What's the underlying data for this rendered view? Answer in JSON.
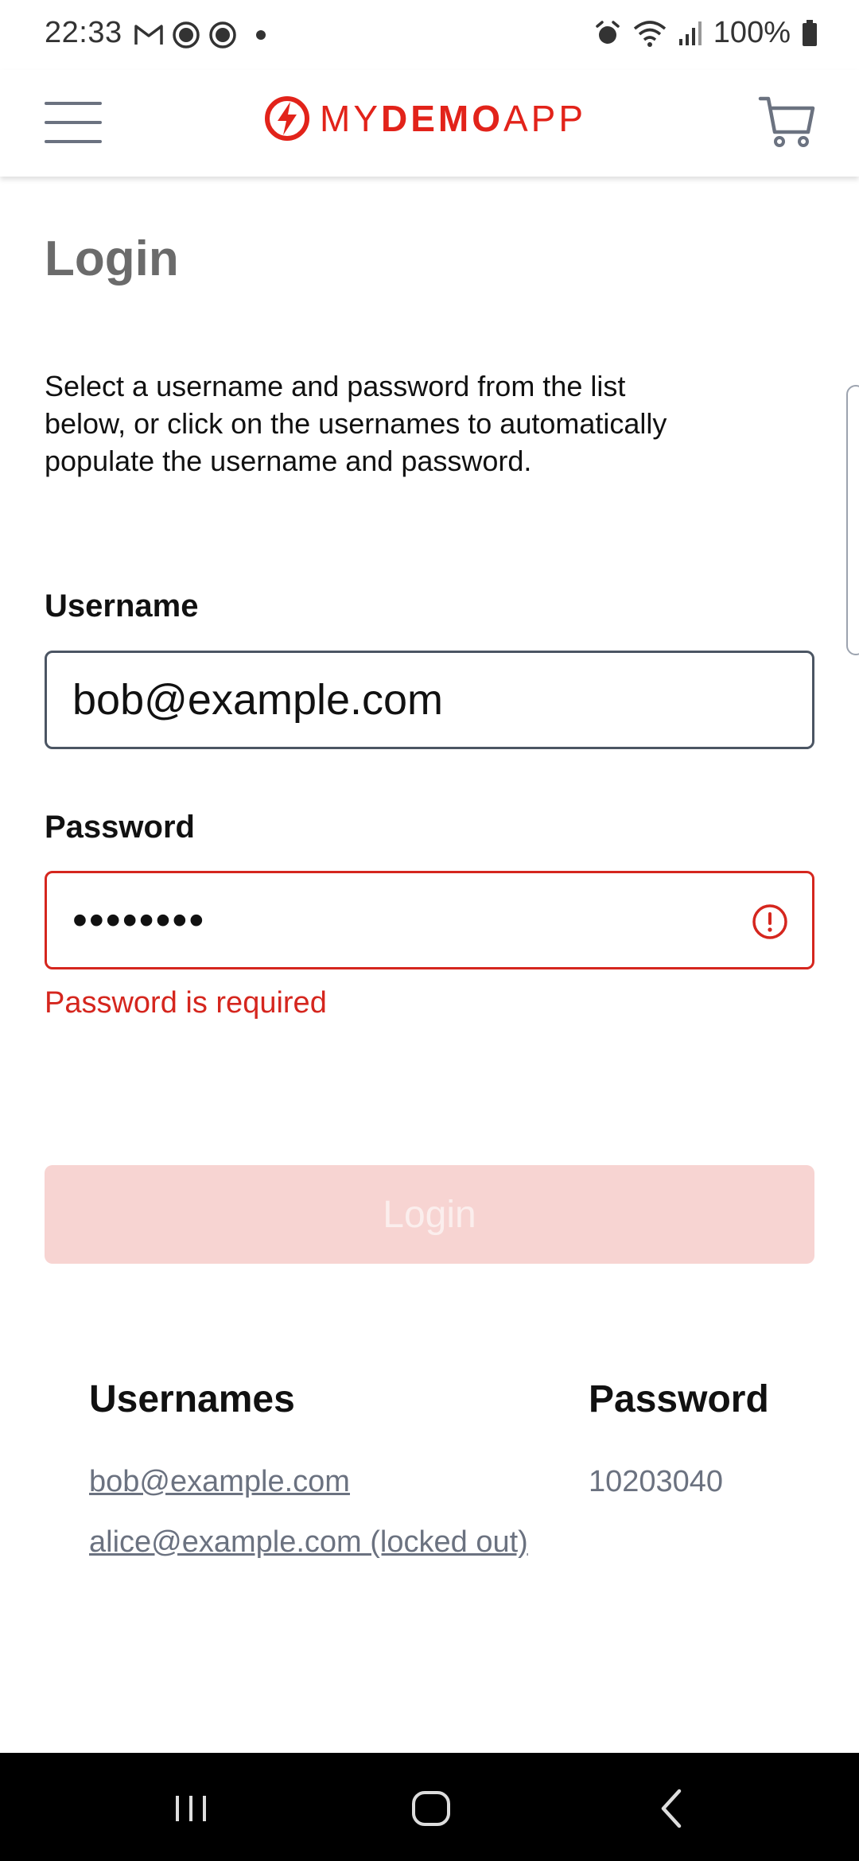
{
  "status_bar": {
    "time": "22:33",
    "battery": "100%",
    "left_icons": [
      "gmail-icon",
      "app-notification-icon",
      "app-notification-icon",
      "more-notifications-dot"
    ],
    "right_icons": [
      "alarm-icon",
      "wifi-icon",
      "signal-icon",
      "battery-icon"
    ]
  },
  "header": {
    "logo_prefix": "MY",
    "logo_strong": "DEMO",
    "logo_suffix": "APP",
    "brand_color": "#e2231a"
  },
  "page": {
    "title": "Login",
    "intro": "Select a username and password from the list below, or click on the usernames to automatically populate the username and password."
  },
  "form": {
    "username_label": "Username",
    "username_value": "bob@example.com",
    "password_label": "Password",
    "password_masked": "••••••••",
    "password_error": "Password is required",
    "login_label": "Login"
  },
  "credentials": {
    "usernames_header": "Usernames",
    "password_header": "Password",
    "users": [
      "bob@example.com",
      "alice@example.com (locked out)"
    ],
    "password": "10203040"
  },
  "colors": {
    "error": "#d5261e",
    "login_button_disabled": "#f7d4d2",
    "muted_text": "#6b7280"
  }
}
